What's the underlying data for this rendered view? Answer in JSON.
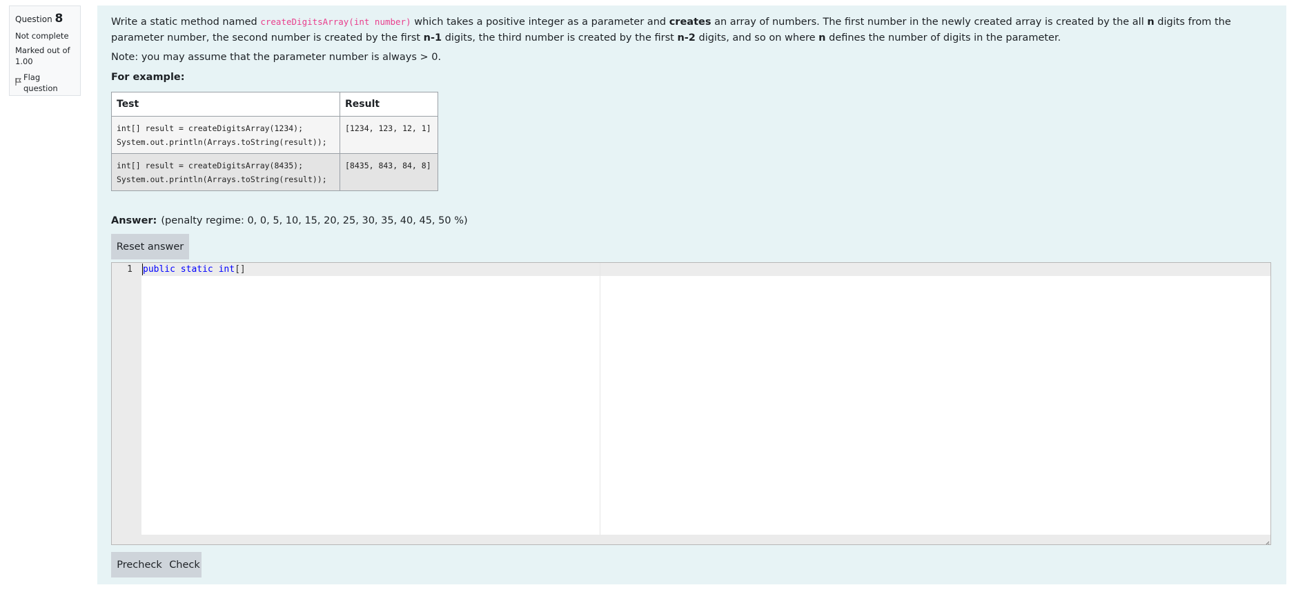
{
  "question_info": {
    "question_word": "Question",
    "question_number": "8",
    "status": "Not complete",
    "marked_out_of": "Marked out of",
    "marks": "1.00",
    "flag_label": "Flag question"
  },
  "prompt": {
    "part1": "Write a static method named ",
    "signature": "createDigitsArray(int number)",
    "part2": " which takes a positive integer as a parameter and ",
    "creates": "creates",
    "part3": " an array of numbers. The first number in the newly created array is created by the all ",
    "n": "n",
    "part4": " digits from the parameter number, the second number is created by the first ",
    "n_minus_1": "n-1",
    "part5": " digits, the third number is created by the first ",
    "n_minus_2": "n-2",
    "part6": " digits, and so on where ",
    "n2": "n",
    "part7": " defines the number of digits in the parameter.",
    "note": "Note: you may assume that the parameter number is always > 0.",
    "for_example": "For example:"
  },
  "examples": {
    "headers": [
      "Test",
      "Result"
    ],
    "rows": [
      {
        "test": "int[] result = createDigitsArray(1234);\nSystem.out.println(Arrays.toString(result));",
        "result": "[1234, 123, 12, 1]"
      },
      {
        "test": "int[] result = createDigitsArray(8435);\nSystem.out.println(Arrays.toString(result));",
        "result": "[8435, 843, 84, 8]"
      }
    ]
  },
  "answer": {
    "label": "Answer:",
    "penalty": "(penalty regime: 0, 0, 5, 10, 15, 20, 25, 30, 35, 40, 45, 50 %)",
    "reset_label": "Reset answer"
  },
  "editor": {
    "line_number": "1",
    "kw1": "public",
    "kw2": "static",
    "kw3": "int",
    "brackets": "[]"
  },
  "actions": {
    "precheck_label": "Precheck",
    "check_label": "Check"
  },
  "colors": {
    "content_bg": "#e7f3f5",
    "keyword": "#0000ff",
    "inline_code": "#e83e8c",
    "button_bg": "#ced4da"
  },
  "icons": {
    "flag": "flag-icon"
  }
}
